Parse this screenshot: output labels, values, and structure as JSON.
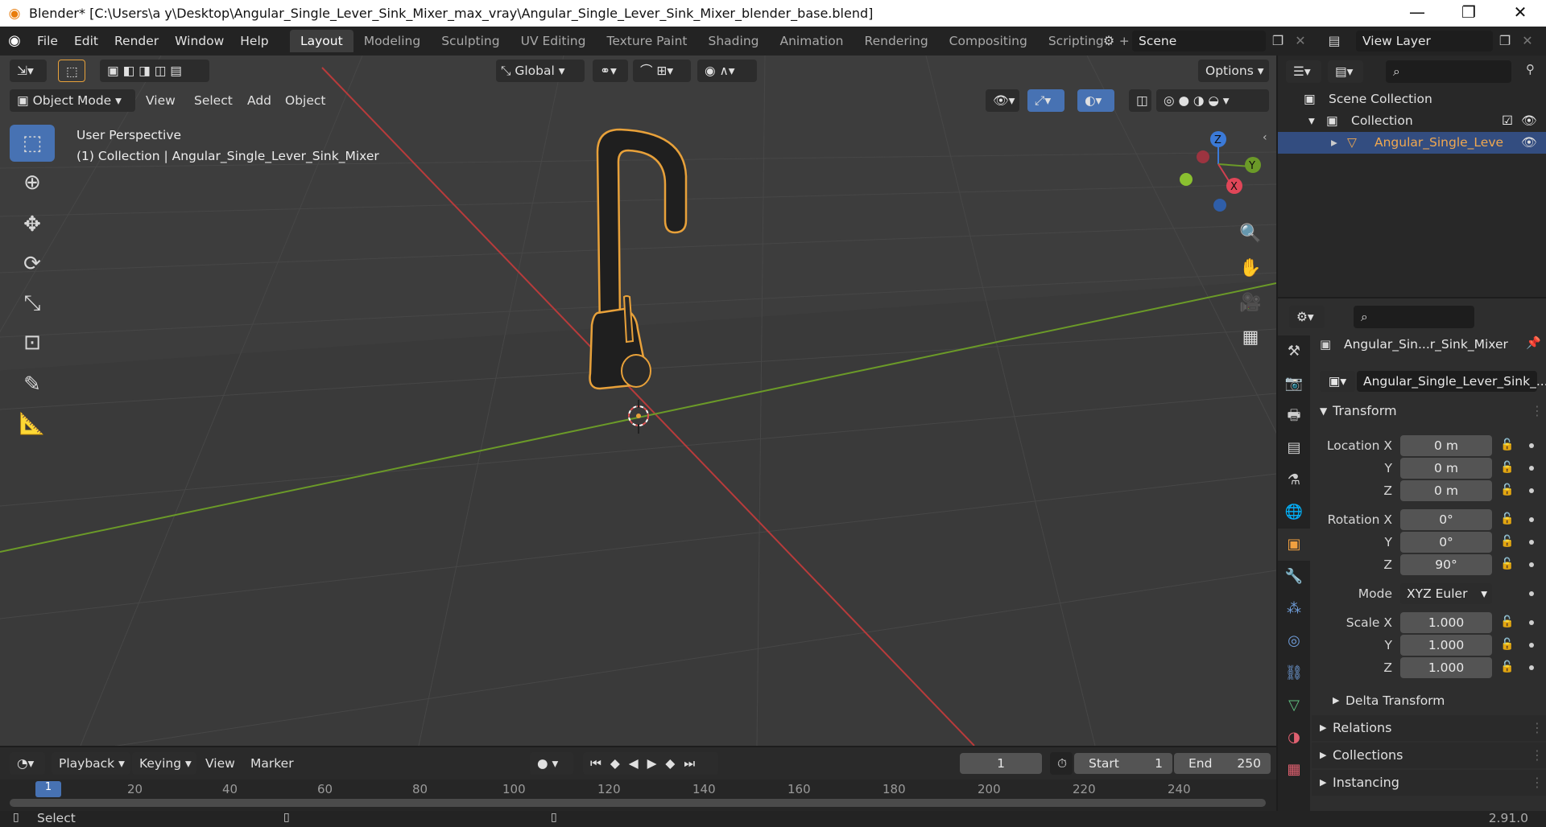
{
  "title_bar": {
    "title": "Blender* [C:\\Users\\a y\\Desktop\\Angular_Single_Lever_Sink_Mixer_max_vray\\Angular_Single_Lever_Sink_Mixer_blender_base.blend]",
    "minimize": "—",
    "maximize": "❐",
    "close": "✕"
  },
  "menu": [
    "File",
    "Edit",
    "Render",
    "Window",
    "Help"
  ],
  "workspaces": [
    "Layout",
    "Modeling",
    "Sculpting",
    "UV Editing",
    "Texture Paint",
    "Shading",
    "Animation",
    "Rendering",
    "Compositing",
    "Scripting"
  ],
  "workspace_add": "+",
  "scene": "Scene",
  "view_layer": "View Layer",
  "viewport_header": {
    "orientation": "Global",
    "options": "Options"
  },
  "viewport_header2": {
    "mode": "Object Mode",
    "menus": [
      "View",
      "Select",
      "Add",
      "Object"
    ]
  },
  "viewport_info": {
    "line1": "User Perspective",
    "line2": "(1) Collection | Angular_Single_Lever_Sink_Mixer"
  },
  "gizmo": {
    "z": "Z",
    "y": "Y",
    "x": "X"
  },
  "timeline": {
    "menus": [
      "Playback",
      "Keying",
      "View",
      "Marker"
    ],
    "current_frame": "1",
    "start_label": "Start",
    "start": "1",
    "end_label": "End",
    "end": "250",
    "ticks": [
      "1",
      "20",
      "40",
      "60",
      "80",
      "100",
      "120",
      "140",
      "160",
      "180",
      "200",
      "220",
      "240"
    ]
  },
  "statusbar": {
    "left": "Select",
    "version": "2.91.0"
  },
  "outliner": {
    "scene_collection": "Scene Collection",
    "collection": "Collection",
    "object": "Angular_Single_Leve"
  },
  "properties": {
    "object_name": "Angular_Sin...r_Sink_Mixer",
    "data_name": "Angular_Single_Lever_Sink_...",
    "transform_label": "Transform",
    "location_label": "Location X",
    "rotation_label": "Rotation X",
    "scale_label": "Scale X",
    "axis_y": "Y",
    "axis_z": "Z",
    "location": [
      "0 m",
      "0 m",
      "0 m"
    ],
    "rotation": [
      "0°",
      "0°",
      "90°"
    ],
    "mode_label": "Mode",
    "mode": "XYZ Euler",
    "scale": [
      "1.000",
      "1.000",
      "1.000"
    ],
    "subpanels": [
      "Delta Transform",
      "Relations",
      "Collections",
      "Instancing"
    ]
  },
  "colors": {
    "accent": "#4772b3",
    "selected_outline": "#e8a13a",
    "x_axis": "#b83b3b",
    "y_axis": "#6b9a28"
  }
}
